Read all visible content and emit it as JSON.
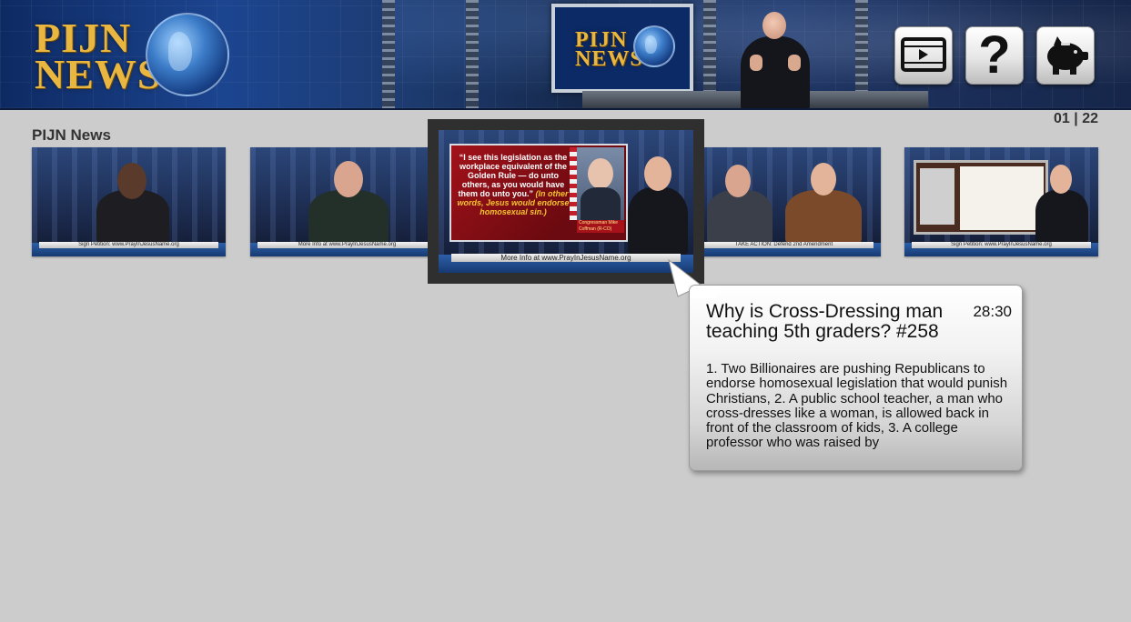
{
  "header": {
    "logo_line1": "PIJN",
    "logo_line2": "NEWS",
    "monitor_logo_line1": "PIJN",
    "monitor_logo_line2": "NEWS",
    "buttons": [
      {
        "name": "videos",
        "icon": "video-player-icon"
      },
      {
        "name": "help",
        "icon": "question-mark-icon",
        "glyph": "?"
      },
      {
        "name": "donate",
        "icon": "piggy-bank-icon"
      }
    ]
  },
  "section": {
    "title": "PIJN News",
    "page_counter": "01 | 22"
  },
  "thumbnails": [
    {
      "ticker": "Sign Petition: www.PrayInJesusName.org"
    },
    {
      "ticker": "More Info at www.PrayInJesusName.org"
    },
    {
      "ticker": "More Info at www.PrayInJesusName.org",
      "quote": "“I see this legislation as the workplace equivalent of the Golden Rule — do unto others, as you would have them do unto you.”",
      "quote_emphasis": "(In other words, Jesus would endorse homosexual sin.)",
      "caption": "Congressman Mike Coffman (R-CO)",
      "selected": true
    },
    {
      "ticker": "TAKE ACTION: Defend 2nd Amendment"
    },
    {
      "ticker": "Sign Petition: www.PrayInJesusName.org"
    }
  ],
  "tooltip": {
    "title": "Why is Cross-Dressing man teaching 5th graders? #258",
    "duration": "28:30",
    "description": "1. Two Billionaires are pushing Republicans to endorse homosexual legislation that would punish Christians, 2. A public school teacher, a man who cross-dresses like a woman, is allowed back in front of the classroom of kids, 3. A college professor who was raised by"
  }
}
